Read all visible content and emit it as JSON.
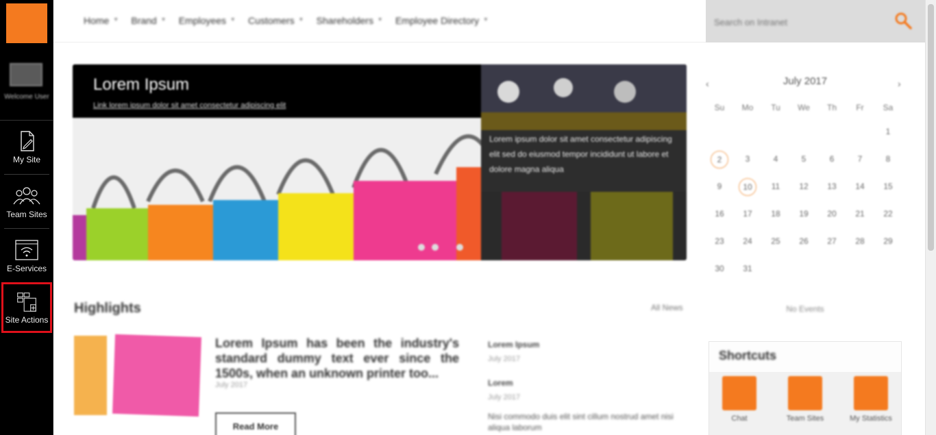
{
  "sidebar": {
    "profile_name": "Welcome User",
    "items": [
      {
        "label": "My Site"
      },
      {
        "label": "Team Sites"
      },
      {
        "label": "E-Services"
      },
      {
        "label": "Site Actions"
      }
    ]
  },
  "topnav": {
    "items": [
      "Home",
      "Brand",
      "Employees",
      "Customers",
      "Shareholders",
      "Employee Directory"
    ]
  },
  "search": {
    "placeholder": "Search on Intranet"
  },
  "hero": {
    "title": "Lorem Ipsum",
    "subtitle": "Link lorem ipsum dolor sit amet consectetur adipiscing elit",
    "side_text": "Lorem ipsum dolor sit amet consectetur adipiscing elit sed do eiusmod tempor incididunt ut labore et dolore magna aliqua"
  },
  "highlights": {
    "title": "Highlights",
    "more": "All News",
    "headline": "Lorem Ipsum has been the industry's standard dummy text ever since the 1500s, when an unknown printer too...",
    "date": "July 2017",
    "read_more": "Read More",
    "news": [
      {
        "title": "Lorem Ipsum",
        "date": "July 2017"
      },
      {
        "title": "Lorem",
        "date": "July 2017"
      }
    ],
    "news_text": "Nisi commodo duis elit sint cillum nostrud amet nisi aliqua laborum"
  },
  "calendar": {
    "month": "July 2017",
    "prev": "‹",
    "next": "›",
    "days": [
      "Su",
      "Mo",
      "Tu",
      "We",
      "Th",
      "Fr",
      "Sa"
    ],
    "dates": [
      "1",
      "2",
      "3",
      "4",
      "5",
      "6",
      "7",
      "8",
      "9",
      "10",
      "11",
      "12",
      "13",
      "14",
      "15",
      "16",
      "17",
      "18",
      "19",
      "20",
      "21",
      "22",
      "23",
      "24",
      "25",
      "26",
      "27",
      "28",
      "29",
      "30",
      "31"
    ],
    "marked": [
      "2",
      "10"
    ],
    "events": "No Events"
  },
  "shortcuts": {
    "title": "Shortcuts",
    "items": [
      {
        "label": "Chat",
        "icon": "chat-icon"
      },
      {
        "label": "Team Sites",
        "icon": "team-icon"
      },
      {
        "label": "My Statistics",
        "icon": "stats-icon"
      }
    ]
  },
  "colors": {
    "accent": "#f47a1f",
    "highlight": "#e0101a"
  }
}
